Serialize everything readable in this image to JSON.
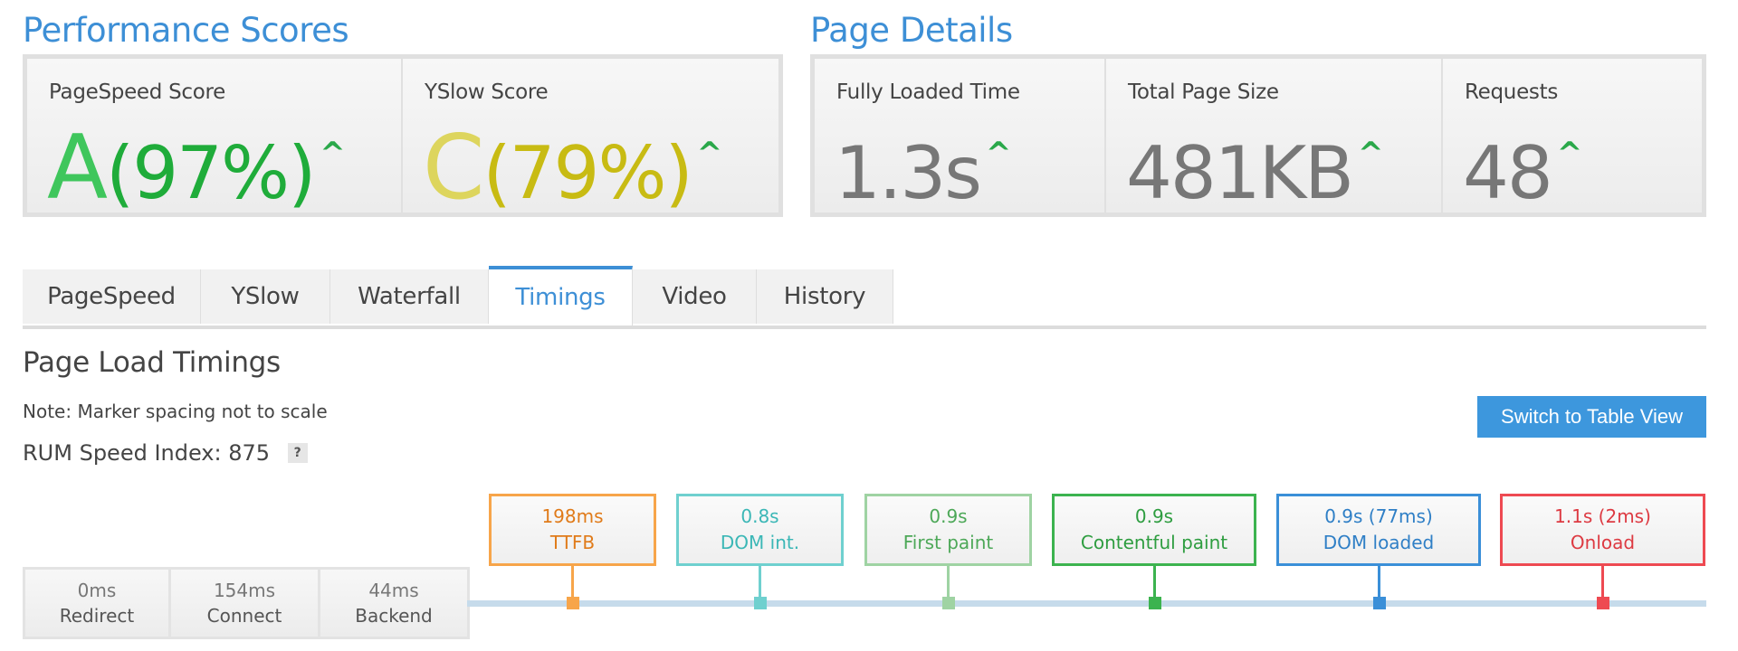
{
  "scores": {
    "title": "Performance Scores",
    "pagespeed": {
      "label": "PageSpeed Score",
      "grade": "A",
      "percent": "(97%)",
      "color": "#1fac3a",
      "grade_color": "#3fc65c"
    },
    "yslow": {
      "label": "YSlow Score",
      "grade": "C",
      "percent": "(79%)",
      "color": "#c8bb13",
      "grade_color": "#ddd55d"
    },
    "arrow_glyph": "^"
  },
  "details": {
    "title": "Page Details",
    "fully_loaded": {
      "label": "Fully Loaded Time",
      "value": "1.3s"
    },
    "page_size": {
      "label": "Total Page Size",
      "value": "481KB"
    },
    "requests": {
      "label": "Requests",
      "value": "48"
    },
    "value_color": "#777777",
    "arrow_color": "#2aa84a"
  },
  "tabs": [
    {
      "label": "PageSpeed",
      "active": false
    },
    {
      "label": "YSlow",
      "active": false
    },
    {
      "label": "Waterfall",
      "active": false
    },
    {
      "label": "Timings",
      "active": true
    },
    {
      "label": "Video",
      "active": false
    },
    {
      "label": "History",
      "active": false
    }
  ],
  "timings": {
    "title": "Page Load Timings",
    "note": "Note: Marker spacing not to scale",
    "rum_label": "RUM Speed Index:",
    "rum_value": "875",
    "help": "?",
    "switch_button": "Switch to Table View",
    "phases": [
      {
        "ms": "0ms",
        "name": "Redirect"
      },
      {
        "ms": "154ms",
        "name": "Connect"
      },
      {
        "ms": "44ms",
        "name": "Backend"
      }
    ],
    "markers": [
      {
        "value": "198ms",
        "name": "TTFB",
        "color": "#f7a54a",
        "text_color": "#e07b1a"
      },
      {
        "value": "0.8s",
        "name": "DOM int.",
        "color": "#6fd0cf",
        "text_color": "#3bb7b6"
      },
      {
        "value": "0.9s",
        "name": "First paint",
        "color": "#9fd3a3",
        "text_color": "#4da858"
      },
      {
        "value": "0.9s",
        "name": "Contentful paint",
        "color": "#3cb34f",
        "text_color": "#2e9d40"
      },
      {
        "value": "0.9s (77ms)",
        "name": "DOM loaded",
        "color": "#3a8fd8",
        "text_color": "#2f7fc6"
      },
      {
        "value": "1.1s (2ms)",
        "name": "Onload",
        "color": "#ee4a52",
        "text_color": "#dd3a42"
      }
    ]
  }
}
